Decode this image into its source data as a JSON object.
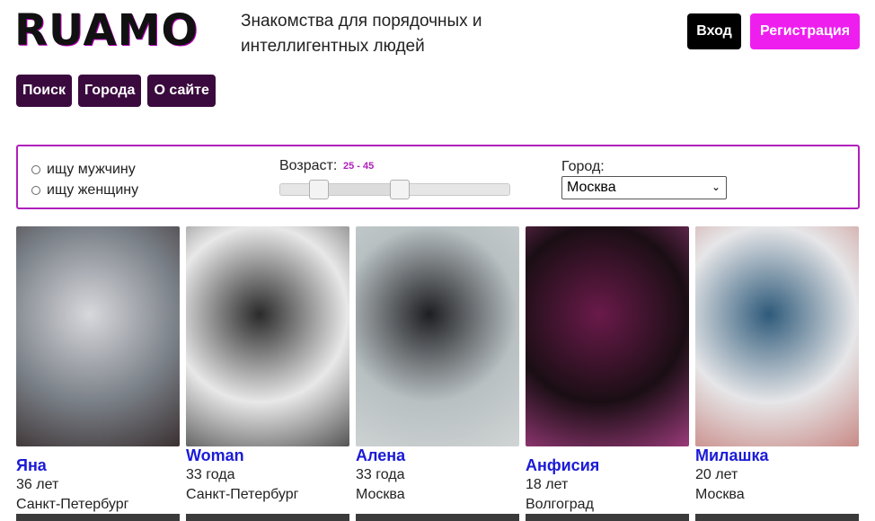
{
  "header": {
    "logo": "RUAMO",
    "tagline": "Знакомства для порядочных и интеллигентных людей",
    "login_label": "Вход",
    "register_label": "Регистрация"
  },
  "nav": {
    "items": [
      "Поиск",
      "Города",
      "О сайте"
    ]
  },
  "filter": {
    "gender_options": [
      "ищу мужчину",
      "ищу женщину"
    ],
    "age_label": "Возраст:",
    "age_value": "25 - 45",
    "age_min": 25,
    "age_max": 45,
    "city_label": "Город:",
    "city_selected": "Москва"
  },
  "cards": [
    {
      "name": "Яна",
      "age": "36 лет",
      "city": "Санкт-Петербург",
      "photo_colors": [
        "#7a8088",
        "#d8d8dc",
        "#3a3030"
      ]
    },
    {
      "name": "Woman",
      "age": "33 года",
      "city": "Санкт-Петербург",
      "photo_colors": [
        "#e8e8e8",
        "#2a2a2a",
        "#555555"
      ]
    },
    {
      "name": "Алена",
      "age": "33 года",
      "city": "Москва",
      "photo_colors": [
        "#b8c0c2",
        "#1e1e22",
        "#d0d4d4"
      ]
    },
    {
      "name": "Анфисия",
      "age": "18 лет",
      "city": "Волгоград",
      "photo_colors": [
        "#1a0e14",
        "#6a1a4a",
        "#9a3a7a"
      ]
    },
    {
      "name": "Милашка",
      "age": "20 лет",
      "city": "Москва",
      "photo_colors": [
        "#e6e6e8",
        "#2e5a7a",
        "#c88a86"
      ]
    }
  ]
}
